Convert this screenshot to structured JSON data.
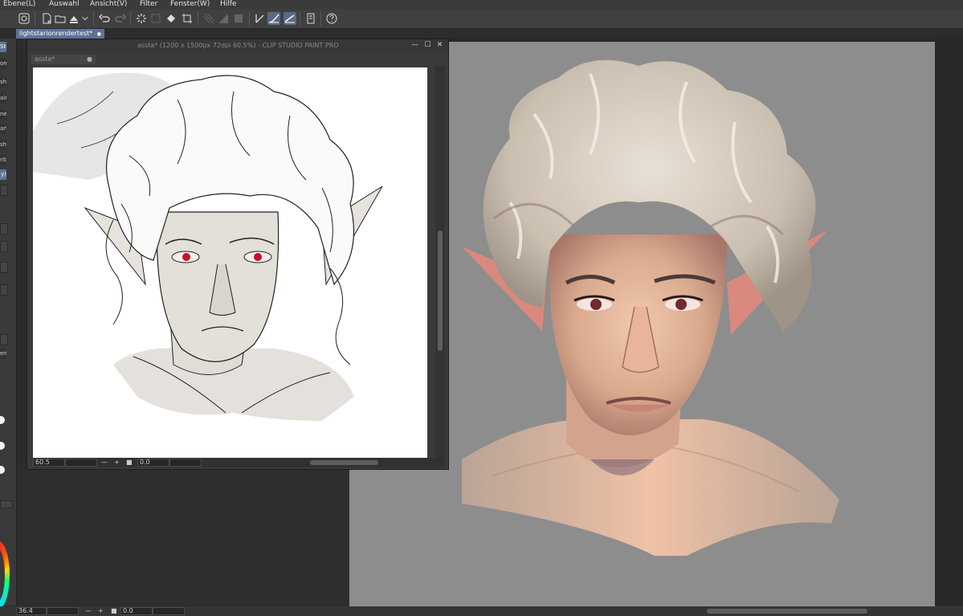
{
  "menu": [
    "Ebene(L)",
    "Auswahl",
    "Ansicht(V)",
    "Filter",
    "Fenster(W)",
    "Hilfe"
  ],
  "toolbar_icons": [
    "app-logo-icon",
    "new-file-icon",
    "open-file-icon",
    "save-icon",
    "export-icon",
    "undo-icon",
    "redo-icon",
    "loading-icon",
    "transform-icon",
    "fill-icon",
    "crop-icon",
    "grid-icon",
    "ruler-icon",
    "frame-icon",
    "pen-icon",
    "brush-pen-icon",
    "line-pen-icon",
    "sidebar-icon",
    "help-icon"
  ],
  "doc_tab": {
    "label": "lightstarionrendertest*",
    "dot": "●"
  },
  "left_panel": {
    "labels": [
      "Ste",
      "om",
      "sh",
      "air",
      "ne",
      "art",
      "sh",
      "rib",
      "y)"
    ],
    "status_label": "endi"
  },
  "main_window": {
    "title": "assta* (1200 x 1500px 72dpi 60.5%) - CLIP STUDIO PAINT PRO",
    "inner_tab": "assta*",
    "inner_tab_dot": "●",
    "zoom": "60.5",
    "rotation": "0.0",
    "minus": "—",
    "plus": "+",
    "stop": "■",
    "minimize": "—",
    "maximize": "☐",
    "close": "✕"
  },
  "bottom_status": {
    "zoom": "36.4",
    "rotation": "0.0",
    "minus": "—",
    "plus": "+",
    "stop": "■"
  },
  "colors": {
    "accent": "#5f7196",
    "canvas_gray": "#8d8d8d",
    "panel": "#3a3a3a",
    "hair": "#d8d0c4",
    "skin": "#e6b9a0",
    "eye_red": "#c8102e"
  }
}
